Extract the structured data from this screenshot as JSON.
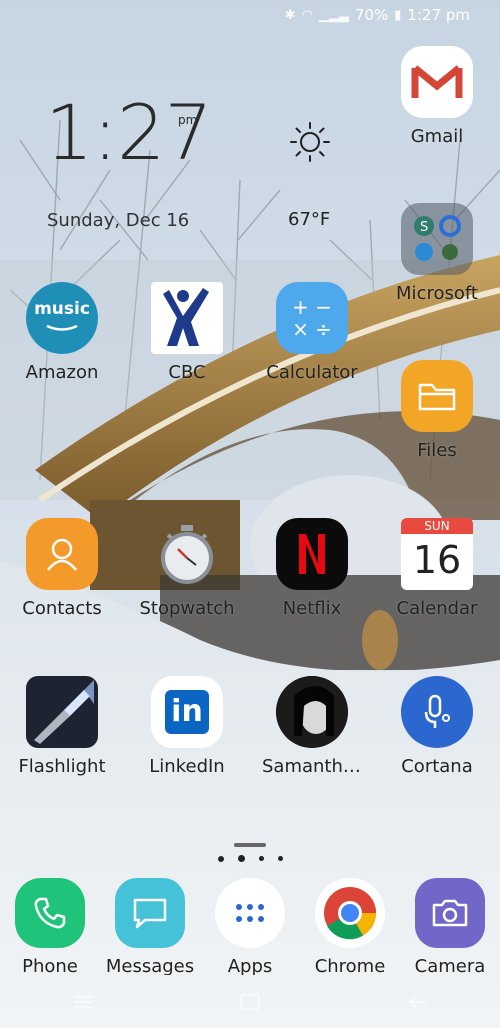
{
  "status_bar": {
    "battery": "70%",
    "time": "1:27 pm",
    "icons": [
      "bluetooth-icon",
      "wifi-icon",
      "signal-icon",
      "battery-icon"
    ]
  },
  "clock_widget": {
    "time": "1:27",
    "ampm": "pm",
    "date": "Sunday, Dec 16",
    "temperature": "67°F",
    "weather_icon": "sun-icon"
  },
  "apps": {
    "gmail": "Gmail",
    "microsoft": "Microsoft",
    "amazon": "Amazon",
    "cbc": "CBC",
    "calculator": "Calculator",
    "files": "Files",
    "contacts": "Contacts",
    "stopwatch": "Stopwatch",
    "netflix": "Netflix",
    "calendar": "Calendar",
    "calendar_day_label": "SUN",
    "calendar_day_number": "16",
    "flashlight": "Flashlight",
    "linkedin": "LinkedIn",
    "samantha": "Samantha ...",
    "cortana": "Cortana",
    "amazon_icon_text": "music",
    "linkedin_icon_text": "in"
  },
  "dock": {
    "phone": "Phone",
    "messages": "Messages",
    "apps": "Apps",
    "chrome": "Chrome",
    "camera": "Camera"
  },
  "colors": {
    "amazon": "#1f8fb8",
    "calculator": "#4ea8ec",
    "files": "#f3a626",
    "contacts": "#f49a2a",
    "netflix": "#0b0b0b",
    "calendar_header": "#e84a3f",
    "cortana": "#2b67cf",
    "phone": "#1fc47a",
    "messages": "#45c1d8",
    "camera": "#7167c9",
    "gmail_red": "#d44638"
  }
}
